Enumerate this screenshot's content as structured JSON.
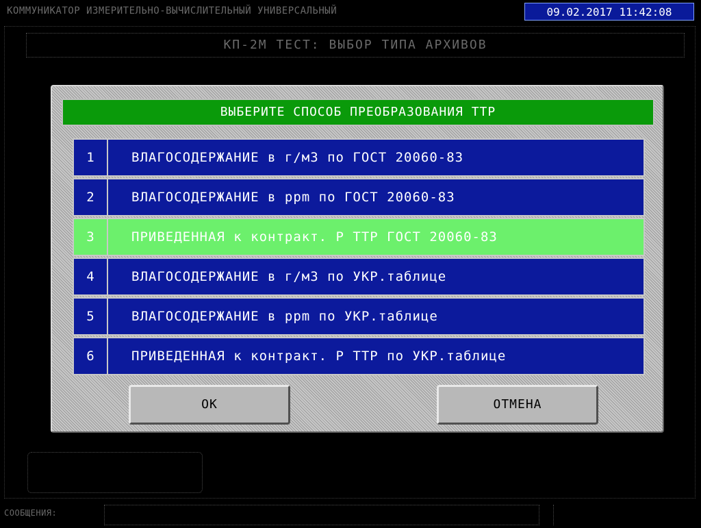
{
  "header": {
    "title": "КОММУНИКАТОР ИЗМЕРИТЕЛЬНО-ВЫЧИСЛИТЕЛЬНЫЙ УНИВЕРСАЛЬНЫЙ",
    "datetime": "09.02.2017 11:42:08"
  },
  "subtitle": "КП-2М ТЕСТ:  ВЫБОР ТИПА АРХИВОВ",
  "dialog": {
    "title": "ВЫБЕРИТЕ СПОСОБ ПРЕОБРАЗОВАНИЯ ТТР",
    "options": [
      {
        "num": "1",
        "text": "ВЛАГОСОДЕРЖАНИЕ в г/м3 по ГОСТ 20060-83"
      },
      {
        "num": "2",
        "text": "ВЛАГОСОДЕРЖАНИЕ в ppm по ГОСТ 20060-83"
      },
      {
        "num": "3",
        "text": "ПРИВЕДЕННАЯ к контракт. Р ТТР ГОСТ 20060-83"
      },
      {
        "num": "4",
        "text": "ВЛАГОСОДЕРЖАНИЕ в г/м3 по УКР.таблице"
      },
      {
        "num": "5",
        "text": "ВЛАГОСОДЕРЖАНИЕ в ppm по УКР.таблице"
      },
      {
        "num": "6",
        "text": "ПРИВЕДЕННАЯ к контракт. Р ТТР по УКР.таблице"
      }
    ],
    "selected_index": 3,
    "ok_label": "ОК",
    "cancel_label": "ОТМЕНА"
  },
  "footer": {
    "messages_label": "СООБЩЕНИЯ:"
  },
  "colors": {
    "option_bg": "#0c1a9c",
    "selected_bg": "#6cf06c",
    "title_bg": "#0a9a0a",
    "datetime_bg": "#0a1a9a"
  }
}
